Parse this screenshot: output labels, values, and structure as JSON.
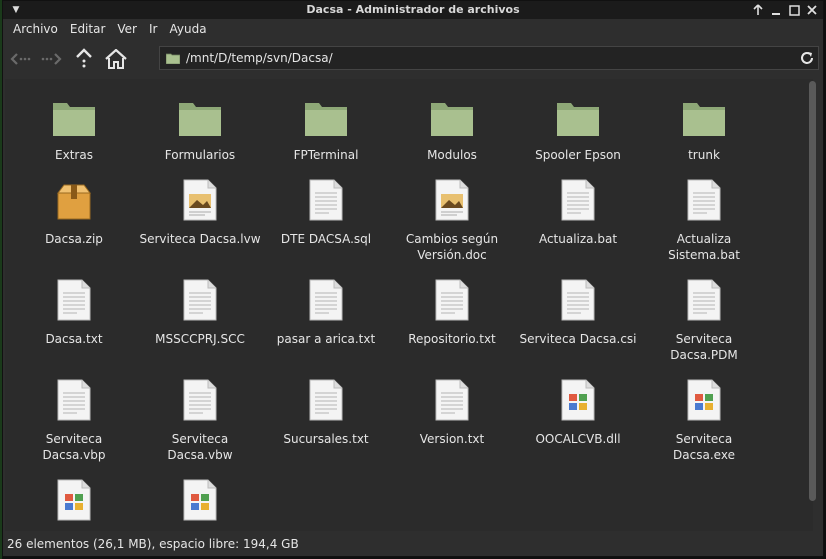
{
  "window": {
    "title": "Dacsa - Administrador de archivos"
  },
  "menubar": {
    "items": [
      "Archivo",
      "Editar",
      "Ver",
      "Ir",
      "Ayuda"
    ]
  },
  "toolbar": {
    "path": "/mnt/D/temp/svn/Dacsa/"
  },
  "files": {
    "row1": [
      {
        "name": "Extras",
        "icon": "folder-icon"
      },
      {
        "name": "Formularios",
        "icon": "folder-icon"
      },
      {
        "name": "FPTerminal",
        "icon": "folder-icon"
      },
      {
        "name": "Modulos",
        "icon": "folder-icon"
      },
      {
        "name": "Spooler Epson",
        "icon": "folder-icon"
      },
      {
        "name": "trunk",
        "icon": "folder-icon"
      }
    ],
    "row2": [
      {
        "name": "Dacsa.zip",
        "icon": "archive-icon"
      },
      {
        "name": "Serviteca Dacsa.lvw",
        "icon": "image-document-icon"
      },
      {
        "name": "DTE DACSA.sql",
        "icon": "text-file-icon"
      },
      {
        "name": "Cambios según Versión.doc",
        "icon": "image-document-icon"
      },
      {
        "name": "Actualiza.bat",
        "icon": "text-file-icon"
      },
      {
        "name": "Actualiza Sistema.bat",
        "icon": "text-file-icon"
      }
    ],
    "row3": [
      {
        "name": "Dacsa.txt",
        "icon": "text-file-icon"
      },
      {
        "name": "MSSCCPRJ.SCC",
        "icon": "text-file-icon"
      },
      {
        "name": "pasar a arica.txt",
        "icon": "text-file-icon"
      },
      {
        "name": "Repositorio.txt",
        "icon": "text-file-icon"
      },
      {
        "name": "Serviteca Dacsa.csi",
        "icon": "text-file-icon"
      },
      {
        "name": "Serviteca Dacsa.PDM",
        "icon": "text-file-icon"
      }
    ],
    "row4": [
      {
        "name": "Serviteca Dacsa.vbp",
        "icon": "text-file-icon"
      },
      {
        "name": "Serviteca Dacsa.vbw",
        "icon": "text-file-icon"
      },
      {
        "name": "Sucursales.txt",
        "icon": "text-file-icon"
      },
      {
        "name": "Version.txt",
        "icon": "text-file-icon"
      },
      {
        "name": "OOCALCVB.dll",
        "icon": "executable-icon"
      },
      {
        "name": "Serviteca Dacsa.exe",
        "icon": "executable-icon"
      }
    ],
    "row5": [
      {
        "name": "",
        "icon": "executable-icon"
      },
      {
        "name": "",
        "icon": "executable-icon"
      }
    ]
  },
  "statusbar": {
    "text": "26 elementos (26,1 MB), espacio libre: 194,4 GB"
  },
  "colors": {
    "folder": "#a9c08f",
    "archive": "#e0a040",
    "background": "#2b2b2b"
  }
}
